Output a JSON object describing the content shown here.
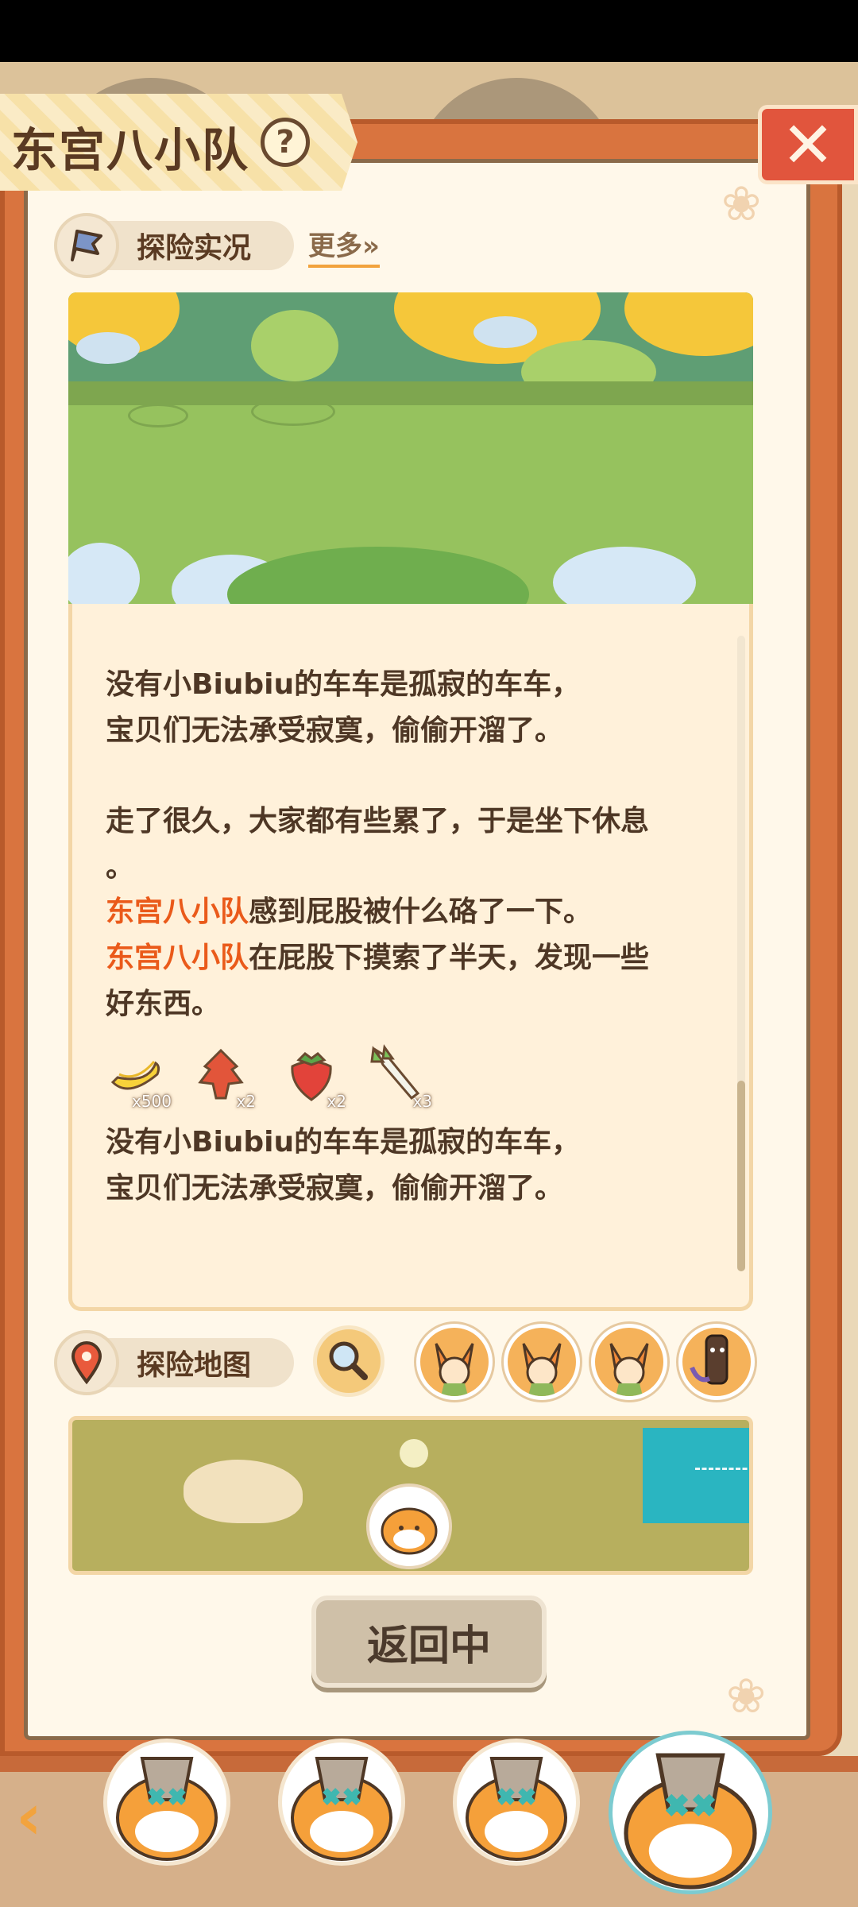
{
  "header": {
    "title": "东宫八小队",
    "help_icon": "?",
    "close_icon": "✕"
  },
  "expedition": {
    "section_label": "探险实况",
    "more_label": "更多»",
    "log": {
      "p1_line1": "没有小Biubiu的车车是孤寂的车车，",
      "p1_line2": "宝贝们无法承受寂寞，偷偷开溜了。",
      "p2_line1": "走了很久，大家都有些累了，于是坐下休息",
      "p2_line2": "。",
      "p3_team": "东宫八小队",
      "p3_rest": "感到屁股被什么硌了一下。",
      "p4_team": "东宫八小队",
      "p4_rest": "在屁股下摸索了半天，发现一些",
      "p4_line2": "好东西。",
      "p5_line1": "没有小Biubiu的车车是孤寂的车车，",
      "p5_line2": "宝贝们无法承受寂寞，偷偷开溜了。"
    },
    "items": [
      {
        "icon": "banana-icon",
        "qty": "x500"
      },
      {
        "icon": "red-plant-icon",
        "qty": "x2"
      },
      {
        "icon": "strawberry-icon",
        "qty": "x2"
      },
      {
        "icon": "scallion-icon",
        "qty": "x3"
      }
    ]
  },
  "map": {
    "section_label": "探险地图"
  },
  "actions": {
    "return_label": "返回中"
  },
  "colors": {
    "accent_orange": "#ea5a1a",
    "close_red": "#e1553d",
    "book_orange": "#d9743f"
  }
}
